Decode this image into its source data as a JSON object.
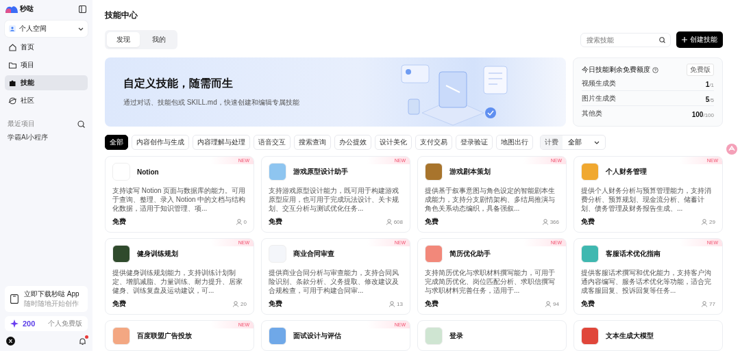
{
  "sidebar": {
    "logo": "秒哒",
    "workspace": "个人空间",
    "nav": [
      {
        "label": "首页",
        "selected": false
      },
      {
        "label": "项目",
        "selected": false
      },
      {
        "label": "技能",
        "selected": true
      },
      {
        "label": "社区",
        "selected": false
      }
    ],
    "recent_title": "最近项目",
    "recent": [
      "学霸AI小程序"
    ],
    "download": {
      "title": "立即下载秒哒 App",
      "subtitle": "随时随地开始创作"
    },
    "credits": {
      "amount": "200",
      "plan": "个人免费版"
    },
    "avatar": "X"
  },
  "page_title": "技能中心",
  "tabs": [
    {
      "label": "发现",
      "selected": true
    },
    {
      "label": "我的",
      "selected": false
    }
  ],
  "search": {
    "placeholder": "搜索技能"
  },
  "create_button": "创建技能",
  "banner": {
    "title": "自定义技能，随需而生",
    "subtitle": "通过对话、技能包或 SKILL.md，快速创建和编辑专属技能"
  },
  "quota": {
    "title": "今日技能剩余免费额度",
    "badge": "免费版",
    "rows": [
      {
        "label": "视频生成类",
        "remaining": "1",
        "total": "/1"
      },
      {
        "label": "图片生成类",
        "remaining": "5",
        "total": "/5"
      },
      {
        "label": "其他类",
        "remaining": "100",
        "total": "/100"
      }
    ]
  },
  "filters": [
    {
      "label": "全部",
      "selected": true
    },
    {
      "label": "内容创作与生成",
      "selected": false
    },
    {
      "label": "内容理解与处理",
      "selected": false
    },
    {
      "label": "语音交互",
      "selected": false
    },
    {
      "label": "搜索查询",
      "selected": false
    },
    {
      "label": "办公提效",
      "selected": false
    },
    {
      "label": "设计美化",
      "selected": false
    },
    {
      "label": "支付交易",
      "selected": false
    },
    {
      "label": "登录验证",
      "selected": false
    },
    {
      "label": "地图出行",
      "selected": false
    }
  ],
  "billing_filter": {
    "label": "计费",
    "value": "全部"
  },
  "cards": [
    {
      "name": "Notion",
      "badge": "NEW",
      "color": "#ffffff",
      "description": "支持读写 Notion 页面与数据库的能力。可用于查询、整理、录入 Notion 中的文档与结构化数据，适用于知识管理、项...",
      "price": "免费",
      "users": "0"
    },
    {
      "name": "游戏原型设计助手",
      "badge": "NEW",
      "color": "#8ec5f0",
      "description": "支持游戏原型设计能力，既可用于构建游戏原型应用，也可用于完成玩法设计、关卡规划、交互分析与测试优化任务...",
      "price": "免费",
      "users": "608"
    },
    {
      "name": "游戏剧本策划",
      "badge": "NEW",
      "color": "#a8742c",
      "description": "提供基于叙事意图与角色设定的智能剧本生成能力，支持分支剧情架构、多结局推演与角色关系动态编织，具备强叙...",
      "price": "免费",
      "users": "366"
    },
    {
      "name": "个人财务管理",
      "badge": "NEW",
      "color": "#f0a830",
      "description": "提供个人财务分析与预算管理能力，支持消费分析、预算规划、现金流分析、储蓄计划、债务管理及财务报告生成、...",
      "price": "免费",
      "users": "29"
    },
    {
      "name": "健身训练规划",
      "badge": "NEW",
      "color": "#2f4a2c",
      "description": "提供健身训练规划能力，支持训练计划制定、增肌减脂、力量训练、耐力提升、居家健身、训练复盘及运动建议，可...",
      "price": "免费",
      "users": "20"
    },
    {
      "name": "商业合同审查",
      "badge": "NEW",
      "color": "#f4f6fa",
      "description": "提供商业合同分析与审查能力，支持合同风险识别、条款分析、义务提取、修改建议及合规检查，可用于构建合同审...",
      "price": "免费",
      "users": "13"
    },
    {
      "name": "简历优化助手",
      "badge": "NEW",
      "color": "#f2887a",
      "description": "支持简历优化与求职材料撰写能力，可用于完成简历优化、岗位匹配分析、求职信撰写与求职材料完善任务，适用于...",
      "price": "免费",
      "users": "94"
    },
    {
      "name": "客服话术优化指南",
      "badge": "NEW",
      "color": "#3fb8b0",
      "description": "提供客服话术撰写和优化能力，支持客户沟通内容编写、服务话术优化等功能，适合完成客服回复、投诉回复等任务...",
      "price": "免费",
      "users": "77"
    },
    {
      "name": "百度联盟广告投放",
      "badge": "NEW",
      "color": "#f3a782"
    },
    {
      "name": "面试设计与评估",
      "badge": "NEW",
      "color": "#6fa8e8"
    },
    {
      "name": "登录",
      "color": "#cfe5d2"
    },
    {
      "name": "文本生成大模型",
      "color": "#e0463a"
    }
  ]
}
